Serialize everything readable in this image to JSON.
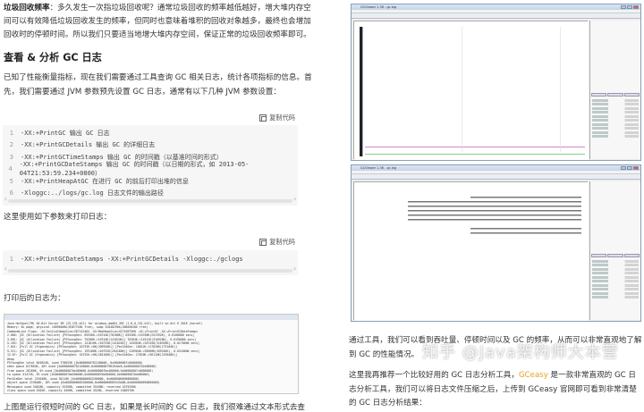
{
  "intro": {
    "term": "垃圾回收频率",
    "text": "：多久发生一次指垃圾回收呢？通常垃圾回收的频率越低越好，增大堆内存空间可以有效降低垃圾回收发生的频率，但同时也意味着堆积的回收对象越多，最终也会增加回收时的停顿时间。所以我们只要适当地增大堆内存空间，保证正常的垃圾回收频率即可。"
  },
  "section_title": "查看 & 分析 GC 日志",
  "section_intro": "已知了性能衡量指标，现在我们需要通过工具查询 GC 相关日志，统计各项指标的信息。首先，我们需要通过 JVM 参数预先设置 GC 日志，通常有以下几种 JVM 参数设置：",
  "copy_label": "复制代码",
  "code1": [
    {
      "num": "1",
      "text": "-XX:+PrintGC 输出 GC 日志"
    },
    {
      "num": "2",
      "text": "-XX:+PrintGCDetails 输出 GC 的详细日志"
    },
    {
      "num": "3",
      "text": "-XX:+PrintGCTimeStamps 输出 GC 的时间戳（以基准时间的形式）"
    },
    {
      "num": "4",
      "text": "-XX:+PrintGCDateStamps 输出 GC 的时间戳（以日期的形式，如 2013-05-04T21:53:59.234+0800）"
    },
    {
      "num": "5",
      "text": "-XX:+PrintHeapAtGC 在进行 GC 的前后打印出堆的信息"
    },
    {
      "num": "6",
      "text": "-Xloggc:../logs/gc.log 日志文件的输出路径"
    }
  ],
  "usage_text": "这里使用如下参数来打印日志：",
  "code2": [
    {
      "num": "1",
      "text": "-XX:+PrintGCDateStamps -XX:+PrintGCDetails -Xloggc:./gclogs"
    }
  ],
  "log_caption": "打印后的日志为：",
  "log_lines": [
    "Java HotSpot(TM) 64-Bit Server VM (25.191-b12) for windows-amd64 JRE (1.8.0_191-b12), built on Oct  6 2018 (kernel)",
    "Memory: 4k page, physical 16696408k(8367748k free), swap 32848296k(20605020k free)",
    "CommandLine flags: -XX:InitialHeapSize=267142464 -XX:MaxHeapSize=4274387968 -XX:+PrintGC -XX:+PrintGCDateStamps",
    "2.000: [GC (Allocation Failure) [PSYoungGen: 65536K->10744K(76288K)] 65536K->10768K(251392K), 0.0100000 secs]",
    "3.601: [GC (Allocation Failure) [PSYoungGen: 76280K->10744K(141824K)] 76304K->14512K(316928K), 0.0190000 secs]",
    "5.103: [GC (Allocation Failure) [PSYoungGen: 141816K->10733K(141824K)] 145584K->28745K(316928K), 0.0270000 secs]",
    "7.041: [Full GC (Ergonomics) [PSYoungGen: 10733K->0K(209920K)] [ParOldGen: 18012K->27816K(175104K)]",
    "9.211: [GC (Allocation Failure) [PSYoungGen: 199168K->10752K(284160K)] 226984K->38568K(459264K), 0.0310000 secs]",
    "12.07: [Full GC (Ergonomics) [PSYoungGen: 10752K->0K(284160K)] [ParOldGen: 27816K->36110K(219648K)]",
    "Heap",
    " PSYoungGen      total 845824K, used 378653K [0x0000000781100000, 0x00000007c0000000)",
    "  eden space 817664K, 46% used [0x0000000781100000,0x0000000798164dc8,0x00000007b2e80000)",
    "  from space 28160K, 0% used [0x00000007be480000,0x00000007be480000,0x00000007c0000000)",
    "  to   space 41472K, 0% used [0x00000007bb500000,0x00000007bb500000,0x00000007bdd80000)",
    " ParOldGen       total 219648K, used 36110K [0x0000000683200000, 0x0000000690880000)",
    "  object space 219648K, 16% used [0x0000000683200000,0x0000000685543a88,0x0000000690880000)",
    " Metaspace       used 34628K, capacity 35398K, committed 35496K, reserved 1079296K",
    "  class space    used 4302K, capacity 4490K, committed 4520K, reserved 1048576K"
  ],
  "last_para": "上图是运行很短时间的 GC 日志，如果是长时间的 GC 日志，我们很难通过文本形式去查",
  "right": {
    "win_title": "GCViewer 1.36 - gc.log",
    "para1": "通过工具，我们可以看到吞吐量、停顿时间以及 GC 的频率，从而可以非常直观地了解到 GC 的性能情况。",
    "para2_a": "这里我再推荐一个比较好用的 GC 日志分析工具，",
    "para2_accent": "GCeasy",
    "para2_b": " 是一款非常直观的 GC 日志分析工具，我们可以将日志文件压缩之后，上传到 GCeasy 官网即可看到非常清楚的 GC 日志分析结果：",
    "watermark": "知乎 @Java架构师大本营",
    "colors": {
      "accent": "#e8a020",
      "window_border": "#8a9db8"
    }
  }
}
